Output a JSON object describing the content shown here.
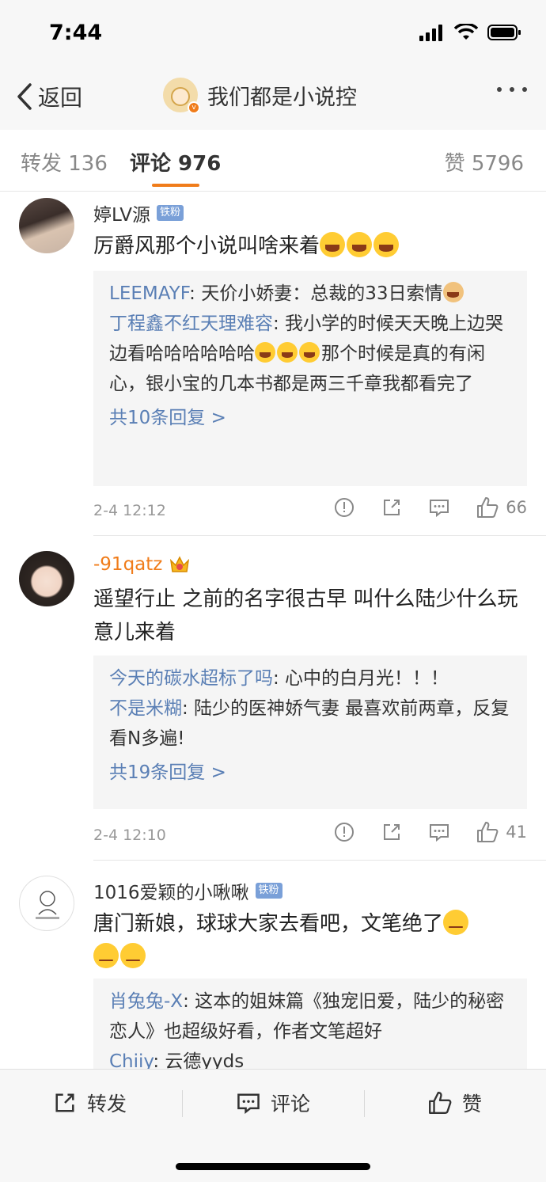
{
  "status_bar": {
    "time": "7:44"
  },
  "nav": {
    "back_label": "返回",
    "title": "我们都是小说控"
  },
  "tabs": [
    {
      "label": "转发 136"
    },
    {
      "label": "评论 976"
    },
    {
      "label": "赞 5796"
    }
  ],
  "comments": [
    {
      "name": "婷LV源",
      "badge": "铁粉",
      "text": "厉爵风那个小说叫啥来着",
      "replies": [
        {
          "user": "LEEMAYF",
          "text": ": 天价小娇妻：总裁的33日索情"
        },
        {
          "user": "丁程鑫不红天理难容",
          "text": ": 我小学的时候天天晚上边哭边看哈哈哈哈哈哈",
          "text2": "那个时候是真的有闲心，银小宝的几本书都是两三千章我都看完了"
        }
      ],
      "more": "共10条回复 >",
      "time": "2-4 12:12",
      "likes": "66"
    },
    {
      "name": "-91qatz",
      "text": "遥望行止 之前的名字很古早 叫什么陆少什么玩意儿来着",
      "replies": [
        {
          "user": "今天的碳水超标了吗",
          "text": ": 心中的白月光！！！"
        },
        {
          "user": "不是米糊",
          "text": ": 陆少的医神娇气妻  最喜欢前两章，反复看N多遍!"
        }
      ],
      "more": "共19条回复 >",
      "time": "2-4 12:10",
      "likes": "41"
    },
    {
      "name": "1016爱颖的小啾啾",
      "badge": "铁粉",
      "text": "唐门新娘，球球大家去看吧，文笔绝了",
      "replies": [
        {
          "user": "肖兔兔-X",
          "text": ": 这本的姐妹篇《独宠旧爱，陆少的秘密恋人》也超级好看，作者文笔超好"
        },
        {
          "user": "Chiiy",
          "text": ": 云德yyds"
        }
      ]
    }
  ],
  "bottom_bar": {
    "repost": "转发",
    "comment": "评论",
    "like": "赞"
  }
}
